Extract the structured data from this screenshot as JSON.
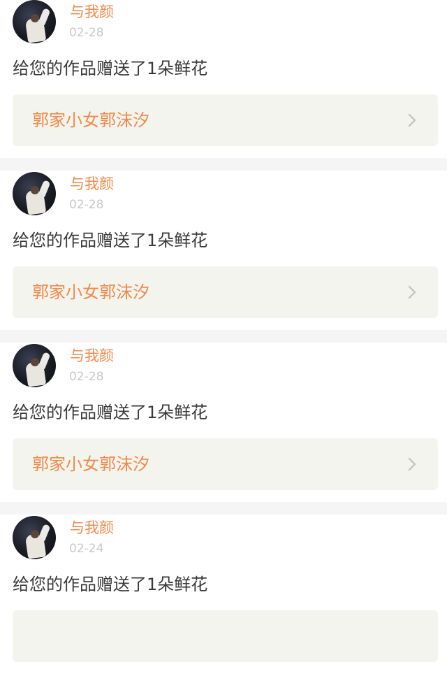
{
  "notifications": [
    {
      "username": "与我颜",
      "date": "02-28",
      "message": "给您的作品赠送了1朵鲜花",
      "work_title": "郭家小女郭沫汐"
    },
    {
      "username": "与我颜",
      "date": "02-28",
      "message": "给您的作品赠送了1朵鲜花",
      "work_title": "郭家小女郭沫汐"
    },
    {
      "username": "与我颜",
      "date": "02-28",
      "message": "给您的作品赠送了1朵鲜花",
      "work_title": "郭家小女郭沫汐"
    },
    {
      "username": "与我颜",
      "date": "02-24",
      "message": "给您的作品赠送了1朵鲜花",
      "work_title": ""
    }
  ],
  "colors": {
    "accent": "#f08a4b",
    "message_text": "#3a3a3a",
    "date_text": "#c8c8c8",
    "link_card_bg": "#f4f4ee",
    "separator_bg": "#f5f5f5"
  },
  "icons": {
    "avatar": "user-avatar",
    "chevron": "chevron-right-icon"
  }
}
